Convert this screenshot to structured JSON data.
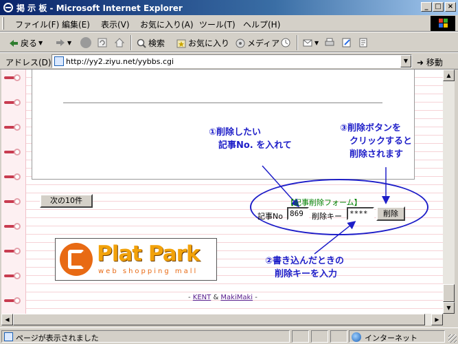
{
  "window": {
    "title": "掲 示 板 - Microsoft Internet Explorer",
    "min_glyph": "_",
    "max_glyph": "□",
    "close_glyph": "×"
  },
  "menu": [
    "ファイル(F)",
    "編集(E)",
    "表示(V)",
    "お気に入り(A)",
    "ツール(T)",
    "ヘルプ(H)"
  ],
  "toolbar": {
    "back": "戻る",
    "search": "検索",
    "favorites": "お気に入り",
    "media": "メディア"
  },
  "address": {
    "label": "アドレス(D)",
    "url": "http://yy2.ziyu.net/yybbs.cgi",
    "go": "移動"
  },
  "page": {
    "next_button": "次の10件",
    "form_title": "【記事削除フォーム】",
    "no_label": "記事No",
    "no_value": "869",
    "key_label": "削除キー",
    "key_value": "****",
    "delete_button": "削除",
    "note1": [
      "①削除したい",
      "記事No. を入れて"
    ],
    "note2": [
      "③削除ボタンを",
      "クリックすると",
      "削除されます"
    ],
    "note3": [
      "②書き込んだときの",
      "削除キーを入力"
    ],
    "banner": {
      "brand": "Plat Park",
      "tagline": "web shopping mall"
    },
    "credits": {
      "prefix": "- ",
      "a1": "KENT",
      "mid": " & ",
      "a2": "MakiMaki",
      "suffix": " -"
    }
  },
  "status": {
    "text": "ページが表示されました",
    "zone": "インターネット"
  },
  "colors": {
    "annotation": "#1e1ec8",
    "form_title": "#008000",
    "brand_yellow": "#f2a20a",
    "brand_orange": "#e86a14"
  }
}
